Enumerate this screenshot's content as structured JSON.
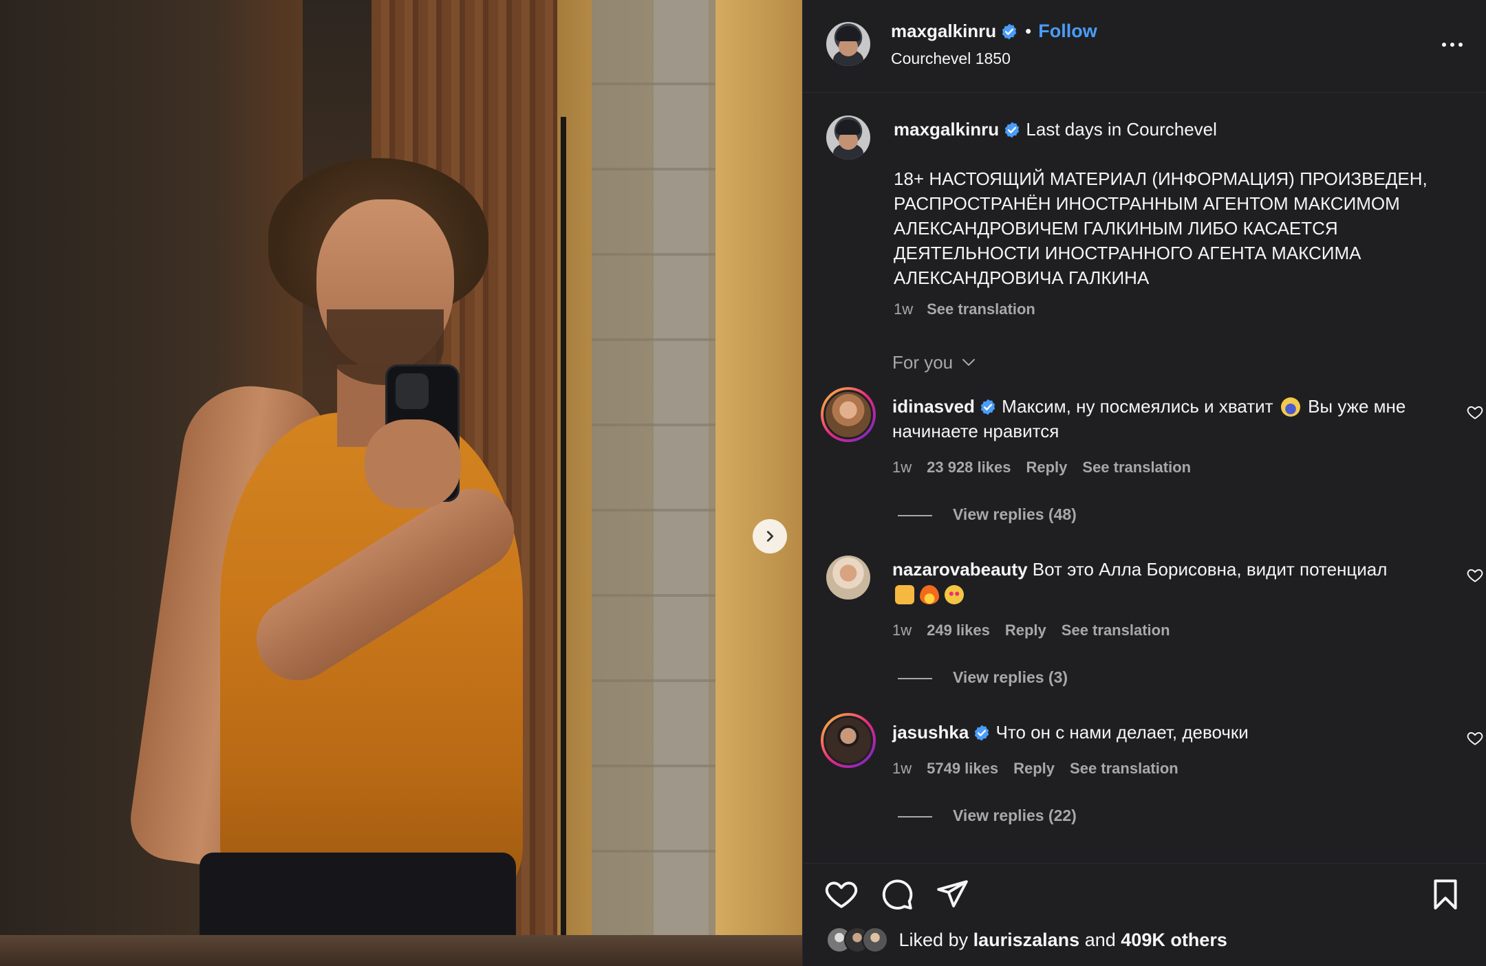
{
  "post": {
    "author": "maxgalkinru",
    "follow_label": "Follow",
    "dot": "•",
    "location": "Courchevel 1850"
  },
  "caption": {
    "username": "maxgalkinru",
    "title": "Last days in Courchevel",
    "body": "18+ НАСТОЯЩИЙ МАТЕРИАЛ (ИНФОРМАЦИЯ) ПРОИЗВЕДЕН, РАСПРОСТРАНЁН ИНОСТРАННЫМ АГЕНТОМ МАКСИМОМ АЛЕКСАНДРОВИЧЕМ ГАЛКИНЫМ ЛИБО КАСАЕТСЯ ДЕЯТЕЛЬНОСТИ ИНОСТРАННОГО АГЕНТА МАКСИМА АЛЕКСАНДРОВИЧА ГАЛКИНА",
    "time": "1w",
    "see_translation": "See translation"
  },
  "for_you": "For you",
  "comments": [
    {
      "username": "idinasved",
      "verified": true,
      "text": "Максим, ну посмеялись и хватит",
      "emoji_after": "scream-emoji",
      "text_after": "Вы уже мне начинаете нравится",
      "time": "1w",
      "likes": "23 928 likes",
      "reply": "Reply",
      "see_translation": "See translation",
      "view_replies": "View replies (48)"
    },
    {
      "username": "nazarovabeauty",
      "verified": false,
      "text": "Вот это Алла Борисовна, видит потенциал",
      "emojis": [
        "raised-hands-emoji",
        "fire-emoji",
        "heart-eyes-emoji"
      ],
      "time": "1w",
      "likes": "249 likes",
      "reply": "Reply",
      "see_translation": "See translation",
      "view_replies": "View replies (3)"
    },
    {
      "username": "jasushka",
      "verified": true,
      "text": "Что он с нами делает, девочки",
      "time": "1w",
      "likes": "5749 likes",
      "reply": "Reply",
      "see_translation": "See translation",
      "view_replies": "View replies (22)"
    }
  ],
  "likes_row": {
    "prefix": "Liked by",
    "user": "lauriszalans",
    "and": "and",
    "others": "409K others"
  },
  "colors": {
    "link": "#4a9df8",
    "verified": "#4a9df8",
    "background": "#1f1f22",
    "muted": "#a8a8a8"
  }
}
